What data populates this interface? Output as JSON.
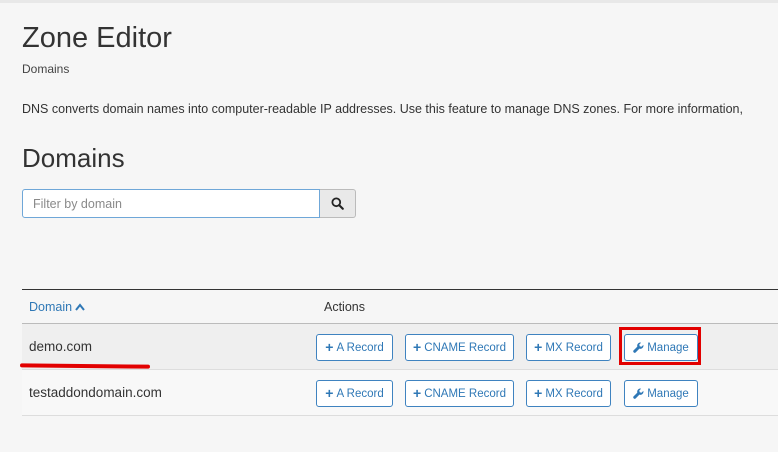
{
  "page": {
    "title": "Zone Editor",
    "breadcrumb": "Domains",
    "description": "DNS converts domain names into computer-readable IP addresses. Use this feature to manage DNS zones. For more information,",
    "section_heading": "Domains"
  },
  "filter": {
    "placeholder": "Filter by domain",
    "value": ""
  },
  "table": {
    "columns": {
      "domain": "Domain",
      "actions": "Actions"
    },
    "sort": "domain ascending",
    "rows": [
      {
        "domain": "demo.com",
        "a_record": "A Record",
        "cname_record": "CNAME Record",
        "mx_record": "MX Record",
        "manage": "Manage",
        "manage_highlighted": true
      },
      {
        "domain": "testaddondomain.com",
        "a_record": "A Record",
        "cname_record": "CNAME Record",
        "mx_record": "MX Record",
        "manage": "Manage",
        "manage_highlighted": false
      }
    ]
  },
  "icons": {
    "search": "search-icon",
    "sort": "chevron-up-icon",
    "add": "plus-icon",
    "manage": "wrench-icon"
  },
  "colors": {
    "accent": "#2f78b6",
    "annotation": "#e20000"
  }
}
